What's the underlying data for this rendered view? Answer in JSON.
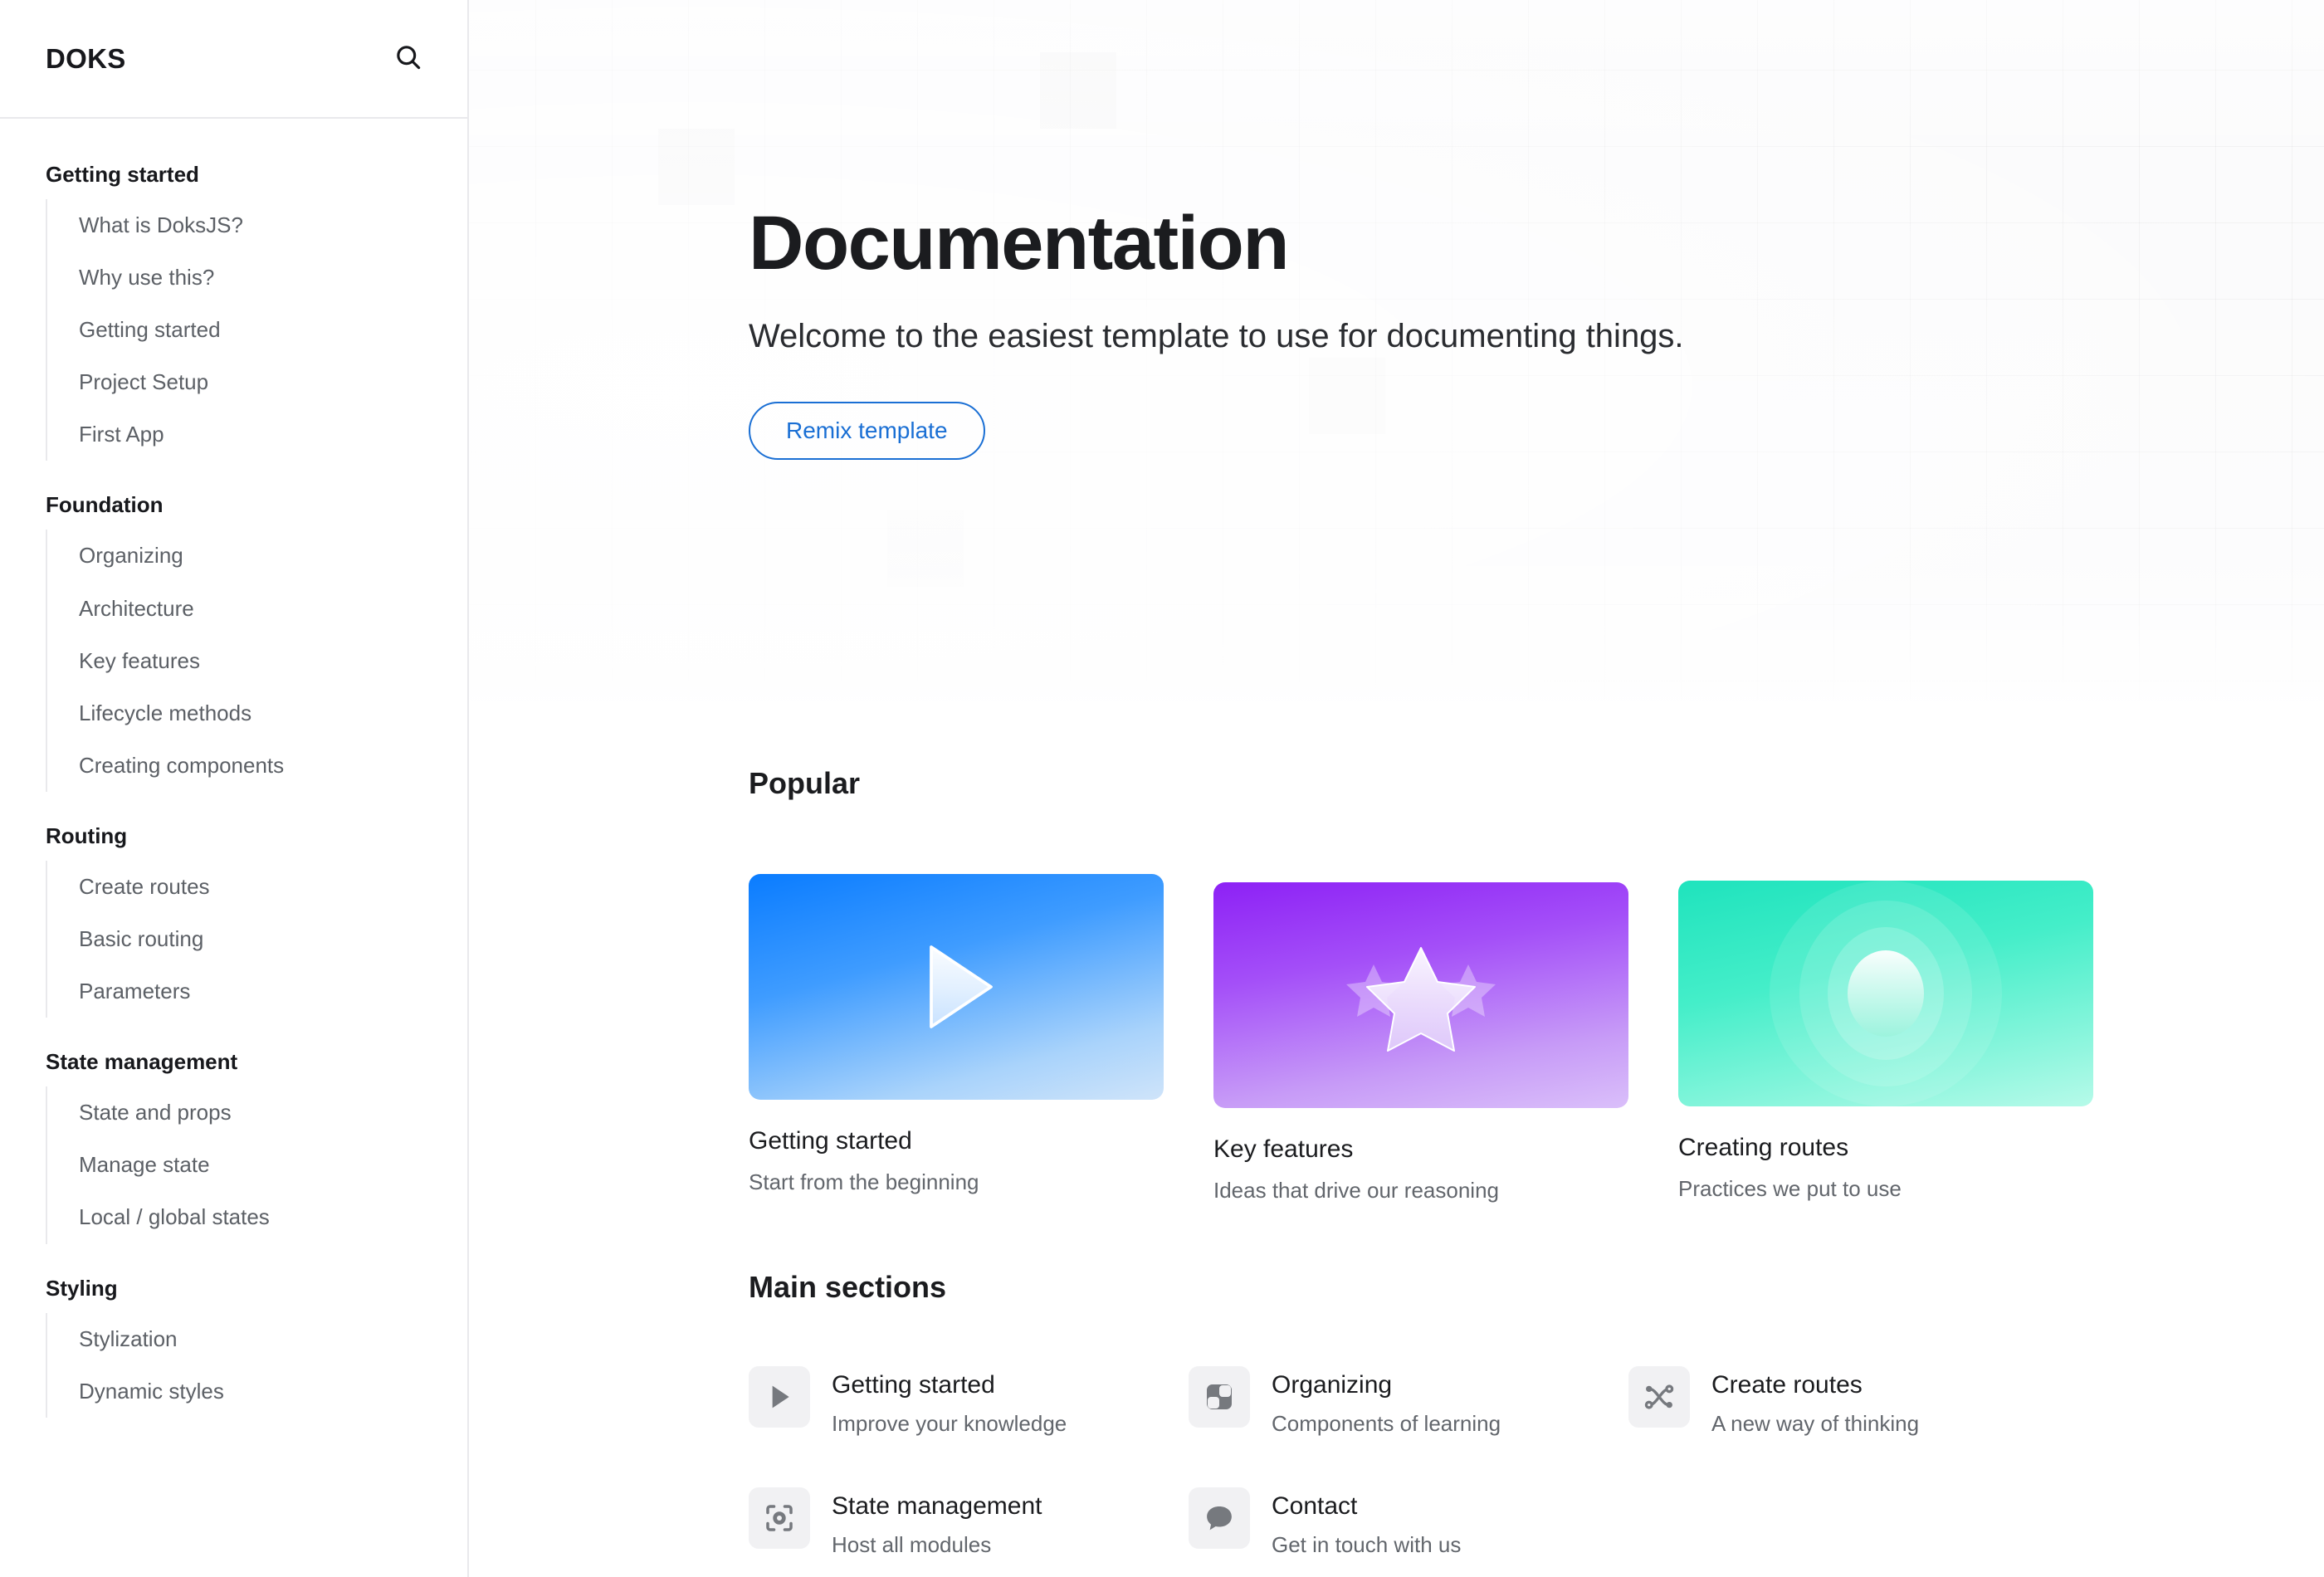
{
  "sidebar": {
    "brand": "DOKS",
    "search_icon": "search-icon",
    "groups": [
      {
        "title": "Getting started",
        "items": [
          "What is DoksJS?",
          "Why use this?",
          "Getting started",
          "Project Setup",
          "First App"
        ]
      },
      {
        "title": "Foundation",
        "items": [
          "Organizing",
          "Architecture",
          "Key features",
          "Lifecycle methods",
          "Creating components"
        ]
      },
      {
        "title": "Routing",
        "items": [
          "Create routes",
          "Basic routing",
          "Parameters"
        ]
      },
      {
        "title": "State management",
        "items": [
          "State and props",
          "Manage state",
          "Local / global states"
        ]
      },
      {
        "title": "Styling",
        "items": [
          "Stylization",
          "Dynamic styles"
        ]
      }
    ]
  },
  "hero": {
    "title": "Documentation",
    "subtitle": "Welcome to the easiest template to use for documenting things.",
    "button_label": "Remix template"
  },
  "popular": {
    "heading": "Popular",
    "cards": [
      {
        "title": "Getting started",
        "desc": "Start from the beginning",
        "art": "play-triangle",
        "color": "#0a7cff"
      },
      {
        "title": "Key features",
        "desc": "Ideas that drive our reasoning",
        "art": "three-stars",
        "color": "#8d21f5"
      },
      {
        "title": "Creating routes",
        "desc": "Practices we put to use",
        "art": "concentric-rings",
        "color": "#1fe3bd"
      }
    ]
  },
  "main_sections": {
    "heading": "Main sections",
    "items": [
      {
        "title": "Getting started",
        "desc": "Improve your knowledge",
        "icon": "play-icon"
      },
      {
        "title": "Organizing",
        "desc": "Components of learning",
        "icon": "layout-grid-icon"
      },
      {
        "title": "Create routes",
        "desc": "A new way of thinking",
        "icon": "shuffle-icon"
      },
      {
        "title": "State management",
        "desc": "Host all modules",
        "icon": "focus-scan-icon"
      },
      {
        "title": "Contact",
        "desc": "Get in touch with us",
        "icon": "chat-bubble-icon"
      }
    ]
  },
  "colors": {
    "accent_blue": "#1a6fd4",
    "text_primary": "#1b1c1f",
    "text_muted": "#62666c",
    "border": "#e9e9ec"
  }
}
